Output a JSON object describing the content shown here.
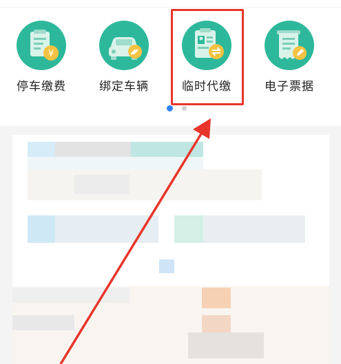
{
  "menu": {
    "items": [
      {
        "label": "停车缴费",
        "icon": "parking-payment-icon"
      },
      {
        "label": "绑定车辆",
        "icon": "bind-vehicle-icon"
      },
      {
        "label": "临时代缴",
        "icon": "temporary-payment-icon"
      },
      {
        "label": "电子票据",
        "icon": "e-receipt-icon"
      }
    ],
    "page_indicator": {
      "current": 1,
      "total": 2
    }
  },
  "colors": {
    "icon_bg": "#2eb89b",
    "icon_accent": "#f5c342",
    "highlight": "#e8352a",
    "indicator_active": "#2f83f0"
  }
}
